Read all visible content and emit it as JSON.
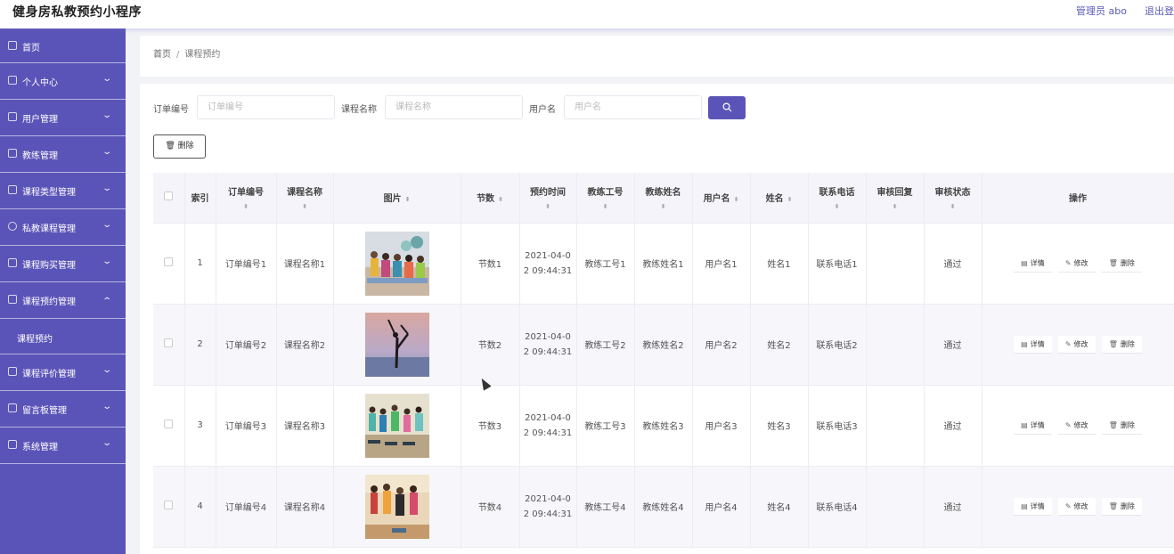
{
  "header": {
    "app_title": "健身房私教预约小程序",
    "admin_label": "管理员 abo",
    "logout_label": "退出登"
  },
  "sidebar": {
    "items": [
      {
        "label": "首页",
        "icon": "home-icon"
      },
      {
        "label": "个人中心",
        "icon": "user-icon",
        "has_arrow": true
      },
      {
        "label": "用户管理",
        "icon": "users-icon",
        "has_arrow": true
      },
      {
        "label": "教练管理",
        "icon": "chat-icon",
        "has_arrow": true
      },
      {
        "label": "课程类型管理",
        "icon": "frame-icon",
        "has_arrow": true
      },
      {
        "label": "私教课程管理",
        "icon": "clock-icon",
        "has_arrow": true
      },
      {
        "label": "课程购买管理",
        "icon": "copy-icon",
        "has_arrow": true
      },
      {
        "label": "课程预约管理",
        "icon": "send-icon",
        "has_arrow": true,
        "expanded": true
      },
      {
        "label": "课程评价管理",
        "icon": "cup-icon",
        "has_arrow": true
      },
      {
        "label": "留言板管理",
        "icon": "mail-icon",
        "has_arrow": true
      },
      {
        "label": "系统管理",
        "icon": "settings-icon",
        "has_arrow": true
      }
    ],
    "submenu": {
      "label": "课程预约"
    }
  },
  "breadcrumb": {
    "home": "首页",
    "separator": "/",
    "current": "课程预约"
  },
  "filters": {
    "order_label": "订单编号",
    "order_placeholder": "订单编号",
    "course_label": "课程名称",
    "course_placeholder": "课程名称",
    "user_label": "用户名",
    "user_placeholder": "用户名"
  },
  "toolbar": {
    "delete_label": "删除"
  },
  "table": {
    "headers": {
      "index": "索引",
      "order_no": "订单编号",
      "course_name": "课程名称",
      "image": "图片",
      "sessions": "节数",
      "booking_time": "预约时间",
      "coach_id": "教练工号",
      "coach_name": "教练姓名",
      "username": "用户名",
      "name": "姓名",
      "phone": "联系电话",
      "review_reply": "审核回复",
      "review_status": "审核状态",
      "actions": "操作"
    },
    "rows": [
      {
        "index": "1",
        "order_no": "订单编号1",
        "course_name": "课程名称1",
        "sessions": "节数1",
        "time_line1": "2021-04-0",
        "time_line2": "2 09:44:31",
        "coach_id": "教练工号1",
        "coach_name": "教练姓名1",
        "username": "用户名1",
        "name": "姓名1",
        "phone": "联系电话1",
        "review_reply": "",
        "review_status": "通过"
      },
      {
        "index": "2",
        "order_no": "订单编号2",
        "course_name": "课程名称2",
        "sessions": "节数2",
        "time_line1": "2021-04-0",
        "time_line2": "2 09:44:31",
        "coach_id": "教练工号2",
        "coach_name": "教练姓名2",
        "username": "用户名2",
        "name": "姓名2",
        "phone": "联系电话2",
        "review_reply": "",
        "review_status": "通过"
      },
      {
        "index": "3",
        "order_no": "订单编号3",
        "course_name": "课程名称3",
        "sessions": "节数3",
        "time_line1": "2021-04-0",
        "time_line2": "2 09:44:31",
        "coach_id": "教练工号3",
        "coach_name": "教练姓名3",
        "username": "用户名3",
        "name": "姓名3",
        "phone": "联系电话3",
        "review_reply": "",
        "review_status": "通过"
      },
      {
        "index": "4",
        "order_no": "订单编号4",
        "course_name": "课程名称4",
        "sessions": "节数4",
        "time_line1": "2021-04-0",
        "time_line2": "2 09:44:31",
        "coach_id": "教练工号4",
        "coach_name": "教练姓名4",
        "username": "用户名4",
        "name": "姓名4",
        "phone": "联系电话4",
        "review_reply": "",
        "review_status": "通过"
      }
    ],
    "actions": {
      "detail": "详情",
      "edit": "修改",
      "delete": "删除"
    }
  },
  "colors": {
    "accent": "#5b54b8",
    "sidebar_bg": "#5b54b8",
    "link": "#5a5ab5"
  }
}
